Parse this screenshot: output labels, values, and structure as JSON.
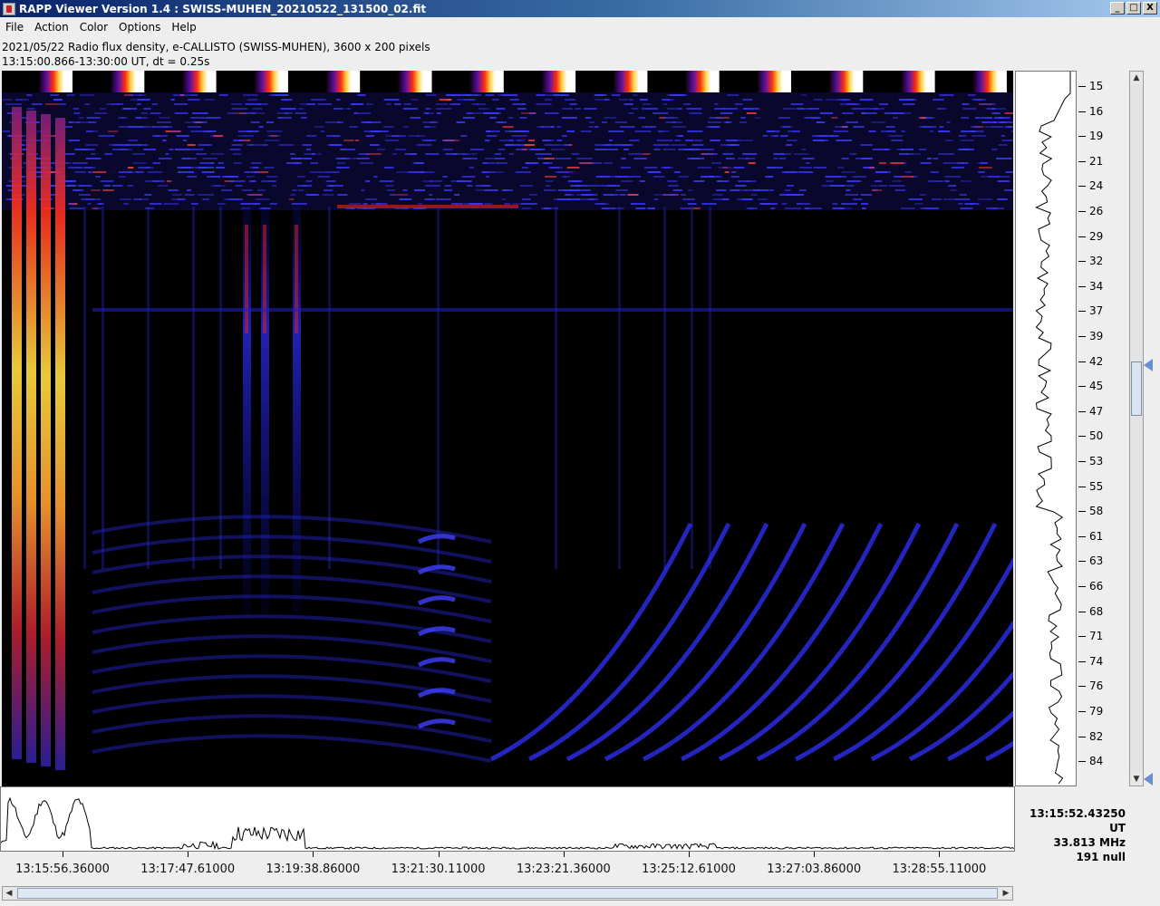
{
  "window": {
    "title": "RAPP Viewer Version 1.4 : SWISS-MUHEN_20210522_131500_02.fit",
    "buttons": [
      "_",
      "□",
      "X"
    ]
  },
  "menu": {
    "items": [
      "File",
      "Action",
      "Color",
      "Options",
      "Help"
    ]
  },
  "info": {
    "line1": "2021/05/22  Radio flux density, e-CALLISTO (SWISS-MUHEN),  3600 x 200 pixels",
    "line2": "13:15:00.866-13:30:00 UT,  dt = 0.25s"
  },
  "frequency_axis": {
    "labels": [
      "15",
      "16",
      "19",
      "21",
      "24",
      "26",
      "29",
      "32",
      "34",
      "37",
      "39",
      "42",
      "45",
      "47",
      "50",
      "53",
      "55",
      "58",
      "61",
      "63",
      "66",
      "68",
      "71",
      "74",
      "76",
      "79",
      "82",
      "84"
    ]
  },
  "time_axis": {
    "labels": [
      "13:15:56.36000",
      "13:17:47.61000",
      "13:19:38.86000",
      "13:21:30.11000",
      "13:23:21.36000",
      "13:25:12.61000",
      "13:27:03.86000",
      "13:28:55.11000"
    ]
  },
  "readout": {
    "time": "13:15:52.43250 UT",
    "freq": "33.813 MHz",
    "value": "191 null"
  },
  "colors": {
    "title_start": "#0a246a",
    "title_end": "#a6caf0",
    "spectrogram_bg": "#000000",
    "emission_blue": "#2020ff",
    "emission_hot": "#ffe040"
  },
  "icons": {
    "app": "app-icon",
    "scroll_up": "arrow-up-icon",
    "scroll_down": "arrow-down-icon",
    "scroll_left": "arrow-left-icon",
    "scroll_right": "arrow-right-icon"
  }
}
